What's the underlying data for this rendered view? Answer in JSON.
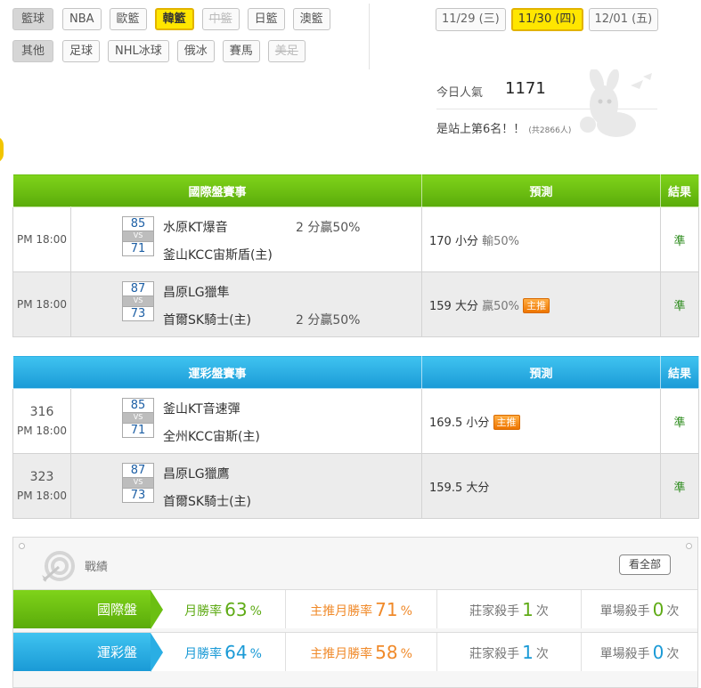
{
  "nav": {
    "row1": {
      "label": "籃球",
      "items": [
        {
          "text": "NBA",
          "state": "normal"
        },
        {
          "text": "歐籃",
          "state": "normal"
        },
        {
          "text": "韓籃",
          "state": "active"
        },
        {
          "text": "中籃",
          "state": "disabled"
        },
        {
          "text": "日籃",
          "state": "normal"
        },
        {
          "text": "澳籃",
          "state": "normal"
        }
      ]
    },
    "row2": {
      "label": "其他",
      "items": [
        {
          "text": "足球",
          "state": "normal"
        },
        {
          "text": "NHL冰球",
          "state": "normal"
        },
        {
          "text": "俄冰",
          "state": "normal"
        },
        {
          "text": "賽馬",
          "state": "normal"
        },
        {
          "text": "美足",
          "state": "disabled"
        }
      ]
    }
  },
  "dates": [
    {
      "text": "11/29 (三)",
      "active": false
    },
    {
      "text": "11/30 (四)",
      "active": true
    },
    {
      "text": "12/01 (五)",
      "active": false
    }
  ],
  "popularity": {
    "label": "今日人氣",
    "value": "1171",
    "rank_text": "是站上第6名！！",
    "total_text": "(共2866人)"
  },
  "international": {
    "header": {
      "match": "國際盤賽事",
      "prediction": "預測",
      "result": "結果"
    },
    "rows": [
      {
        "num": "",
        "time": "PM 18:00",
        "score_away": "85",
        "score_home": "71",
        "vs": "VS",
        "team_away": "水原KT爆音",
        "team_home": "釜山KCC宙斯盾(主)",
        "spread_text": "2 分贏50%",
        "spread_row": "away",
        "pred_main": "170 小分",
        "pred_extra": "輸50%",
        "badge": "",
        "result": "準"
      },
      {
        "num": "",
        "time": "PM 18:00",
        "score_away": "87",
        "score_home": "73",
        "vs": "VS",
        "team_away": "昌原LG獵隼",
        "team_home": "首爾SK騎士(主)",
        "spread_text": "2 分贏50%",
        "spread_row": "home",
        "pred_main": "159 大分",
        "pred_extra": "贏50%",
        "badge": "主推",
        "result": "準"
      }
    ]
  },
  "lottery": {
    "header": {
      "match": "運彩盤賽事",
      "prediction": "預測",
      "result": "結果"
    },
    "rows": [
      {
        "num": "316",
        "time": "PM 18:00",
        "score_away": "85",
        "score_home": "71",
        "vs": "VS",
        "team_away": "釜山KT音速彈",
        "team_home": "全州KCC宙斯(主)",
        "spread_text": "",
        "spread_row": "",
        "pred_main": "169.5 小分",
        "pred_extra": "",
        "badge": "主推",
        "result": "準"
      },
      {
        "num": "323",
        "time": "PM 18:00",
        "score_away": "87",
        "score_home": "73",
        "vs": "VS",
        "team_away": "昌原LG獵鷹",
        "team_home": "首爾SK騎士(主)",
        "spread_text": "",
        "spread_row": "",
        "pred_main": "159.5 大分",
        "pred_extra": "",
        "badge": "",
        "result": "準"
      }
    ]
  },
  "record": {
    "title": "戰績",
    "view_all": "看全部",
    "rows": [
      {
        "label": "國際盤",
        "month_label": "月勝率",
        "month_val": "63",
        "main_label": "主推月勝率",
        "main_val": "71",
        "pct": "%",
        "banker_label": "莊家殺手",
        "banker_val": "1",
        "single_label": "單場殺手",
        "single_val": "0",
        "unit": "次"
      },
      {
        "label": "運彩盤",
        "month_label": "月勝率",
        "month_val": "64",
        "main_label": "主推月勝率",
        "main_val": "58",
        "pct": "%",
        "banker_label": "莊家殺手",
        "banker_val": "1",
        "single_label": "單場殺手",
        "single_val": "0",
        "unit": "次"
      }
    ]
  },
  "colors": {
    "green": "#5aab0a",
    "blue": "#1a9ad6",
    "orange": "#f08a2a",
    "yellow": "#ffe600"
  },
  "icons": {
    "mascot": "rabbit-mascot-icon",
    "record": "target-arrow-icon"
  }
}
